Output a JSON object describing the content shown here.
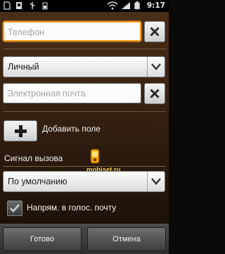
{
  "status_bar": {
    "time": "9:17",
    "icons": [
      "sim-icon",
      "sd-card-icon",
      "usb-icon",
      "battery-small-icon",
      "wifi-icon",
      "signal-icon",
      "battery-icon"
    ]
  },
  "form": {
    "phone_placeholder": "Телефон",
    "phone_type": "Личный",
    "email_placeholder": "Электронная почта",
    "add_field_label": "Добавить поле",
    "ringtone_section_label": "Сигнал вызова",
    "ringtone_value": "По умолчанию",
    "voicemail_label": "Напрям. в голос. почту",
    "voicemail_checked": true
  },
  "watermark": {
    "text": "mobiset.ru"
  },
  "bottom_bar": {
    "done_label": "Готово",
    "cancel_label": "Отмена"
  },
  "colors": {
    "focus": "#ff9d1a",
    "background": "#3a2413",
    "watermark": "#ffd24a"
  }
}
